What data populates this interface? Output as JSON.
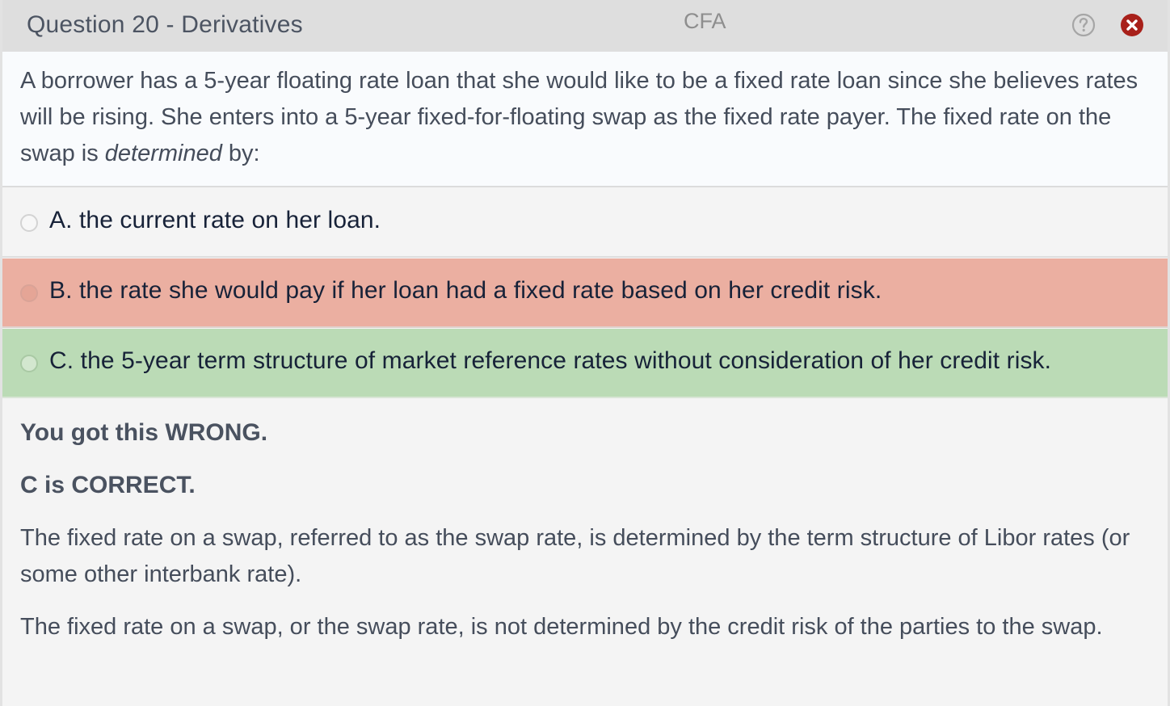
{
  "header": {
    "title": "Question 20 - Derivatives",
    "center_label": "CFA",
    "help_icon": "question-circle-icon",
    "close_icon": "close-circle-icon",
    "close_color": "#a8201a"
  },
  "question": {
    "text_before_italic": "A borrower has a 5-year floating rate loan that she would like to be a fixed rate loan since she believes rates will be rising.  She enters into a 5-year fixed-for-floating swap as the fixed rate payer.  The fixed rate on the swap is ",
    "italic": "determined",
    "text_after_italic": " by:"
  },
  "options": [
    {
      "label": "A. the current rate on her loan.",
      "state": "neutral"
    },
    {
      "label": "B. the rate she would pay if her loan had a fixed rate based on her credit risk.",
      "state": "selected-wrong",
      "color": "#ebafa1"
    },
    {
      "label": "C. the 5-year term structure of market reference rates without consideration of her credit risk.",
      "state": "correct",
      "color": "#bbdbb6"
    }
  ],
  "feedback": {
    "result": "You got this WRONG.",
    "correct": "C is CORRECT.",
    "explanation_1": "The fixed rate on a swap, referred to as the swap rate, is determined by the term structure of Libor rates (or some other interbank rate).",
    "explanation_2": "The fixed rate on a swap, or the swap rate, is not determined by the credit risk of the parties to the swap."
  }
}
